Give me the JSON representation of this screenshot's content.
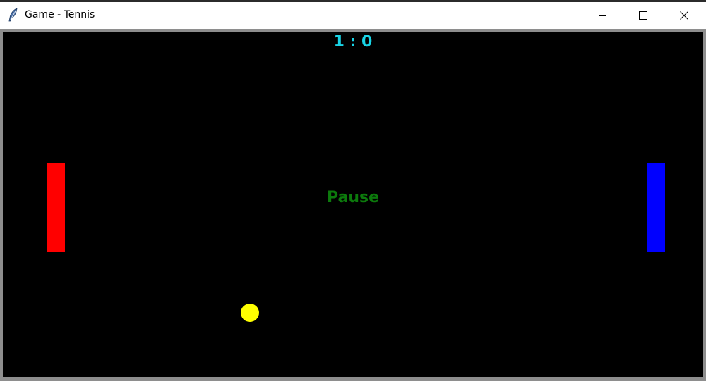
{
  "window": {
    "title": "Game - Tennis",
    "app_icon": "feather-icon",
    "controls": {
      "minimize_icon": "minimize-icon",
      "maximize_icon": "maximize-icon",
      "close_icon": "close-icon"
    }
  },
  "game": {
    "score": "1 : 0",
    "status": "Pause",
    "colors": {
      "background": "#000000",
      "score": "#19d4e6",
      "status": "#0c7a0c",
      "left_paddle": "#ff0000",
      "right_paddle": "#0000ff",
      "ball": "#ffff00"
    }
  }
}
